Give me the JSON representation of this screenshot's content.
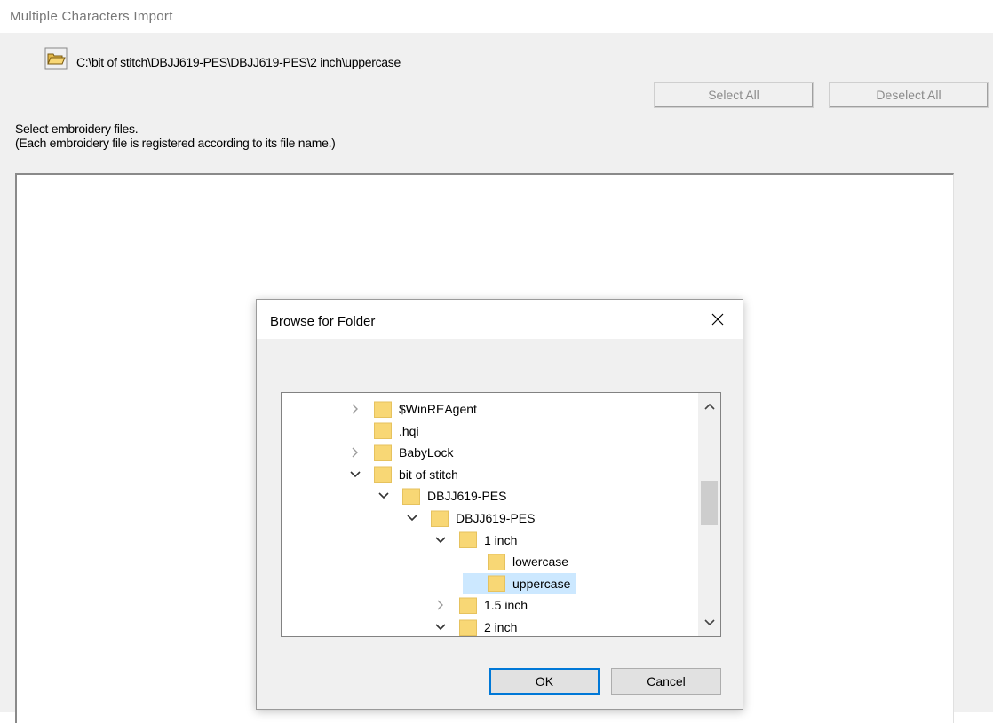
{
  "window": {
    "title": "Multiple Characters Import"
  },
  "path": {
    "value": "C:\\bit of stitch\\DBJJ619-PES\\DBJJ619-PES\\2 inch\\uppercase"
  },
  "buttons": {
    "select_all": "Select All",
    "deselect_all": "Deselect All"
  },
  "instructions": {
    "line1": "Select embroidery files.",
    "line2": "(Each embroidery file is registered according to its file name.)"
  },
  "dialog": {
    "title": "Browse for Folder",
    "ok": "OK",
    "cancel": "Cancel",
    "tree": [
      {
        "label": "$WinREAgent",
        "expander": "collapsed",
        "selected": false
      },
      {
        "label": ".hqi",
        "expander": "none",
        "selected": false
      },
      {
        "label": "BabyLock",
        "expander": "collapsed",
        "selected": false
      },
      {
        "label": "bit of stitch",
        "expander": "expanded",
        "selected": false
      },
      {
        "label": "DBJJ619-PES",
        "expander": "expanded",
        "selected": false
      },
      {
        "label": "DBJJ619-PES",
        "expander": "expanded",
        "selected": false
      },
      {
        "label": "1 inch",
        "expander": "expanded",
        "selected": false
      },
      {
        "label": "lowercase",
        "expander": "none",
        "selected": false
      },
      {
        "label": "uppercase",
        "expander": "none",
        "selected": true
      },
      {
        "label": "1.5 inch",
        "expander": "collapsed",
        "selected": false
      },
      {
        "label": "2 inch",
        "expander": "expanded",
        "selected": false
      }
    ]
  },
  "colors": {
    "folder": "#f8d775",
    "selection": "#cce8ff",
    "accent": "#0078d7"
  },
  "icons": {
    "folder_button": "open-folder-icon",
    "close": "close-icon",
    "tree_folder": "folder-icon"
  }
}
